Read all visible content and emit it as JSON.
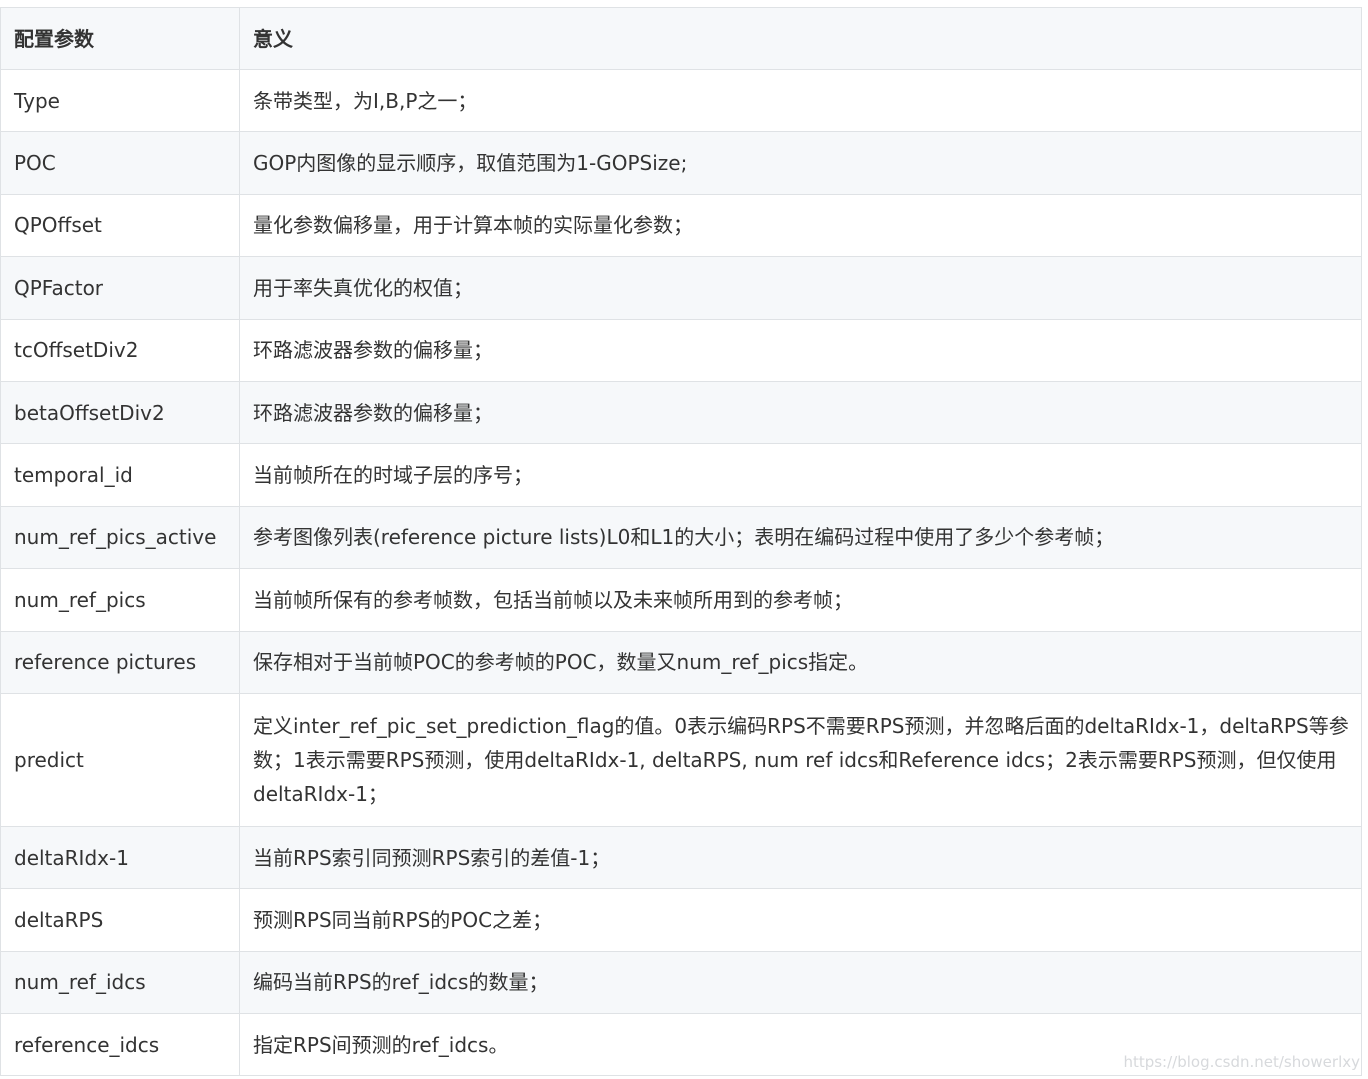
{
  "table": {
    "headers": [
      "配置参数",
      "意义"
    ],
    "rows": [
      {
        "param": "Type",
        "meaning": "条带类型，为I,B,P之一；"
      },
      {
        "param": "POC",
        "meaning": "GOP内图像的显示顺序，取值范围为1-GOPSize;"
      },
      {
        "param": "QPOffset",
        "meaning": "量化参数偏移量，用于计算本帧的实际量化参数；"
      },
      {
        "param": "QPFactor",
        "meaning": "用于率失真优化的权值；"
      },
      {
        "param": "tcOffsetDiv2",
        "meaning": "环路滤波器参数的偏移量；"
      },
      {
        "param": "betaOffsetDiv2",
        "meaning": "环路滤波器参数的偏移量；"
      },
      {
        "param": "temporal_id",
        "meaning": "当前帧所在的时域子层的序号；"
      },
      {
        "param": "num_ref_pics_active",
        "meaning": "参考图像列表(reference picture lists)L0和L1的大小；表明在编码过程中使用了多少个参考帧；"
      },
      {
        "param": "num_ref_pics",
        "meaning": "当前帧所保有的参考帧数，包括当前帧以及未来帧所用到的参考帧；"
      },
      {
        "param": "reference pictures",
        "meaning": "保存相对于当前帧POC的参考帧的POC，数量又num_ref_pics指定。"
      },
      {
        "param": "predict",
        "meaning": "定义inter_ref_pic_set_prediction_flag的值。0表示编码RPS不需要RPS预测，并忽略后面的deltaRIdx-1，deltaRPS等参数；1表示需要RPS预测，使用deltaRIdx-1, deltaRPS, num ref idcs和Reference idcs；2表示需要RPS预测，但仅使用deltaRIdx-1；"
      },
      {
        "param": "deltaRIdx-1",
        "meaning": "当前RPS索引同预测RPS索引的差值-1；"
      },
      {
        "param": "deltaRPS",
        "meaning": "预测RPS同当前RPS的POC之差；"
      },
      {
        "param": "num_ref_idcs",
        "meaning": "编码当前RPS的ref_idcs的数量；"
      },
      {
        "param": "reference_idcs",
        "meaning": "指定RPS间预测的ref_idcs。"
      }
    ]
  },
  "watermark": "https://blog.csdn.net/showerlxy"
}
